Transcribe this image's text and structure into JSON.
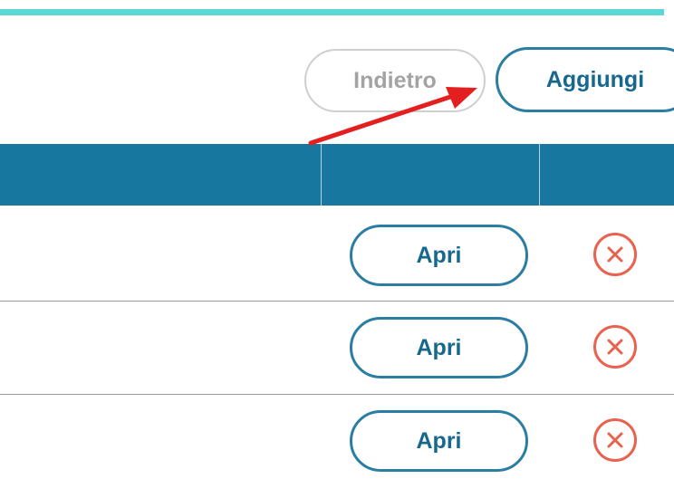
{
  "toolbar": {
    "back_label": "Indietro",
    "add_label": "Aggiungi"
  },
  "rows": [
    {
      "open_label": "Apri"
    },
    {
      "open_label": "Apri"
    },
    {
      "open_label": "Apri"
    }
  ],
  "colors": {
    "accent_top": "#5ad8d5",
    "header_bg": "#17779e",
    "primary": "#2b7ea1",
    "danger": "#e8634f",
    "annotation_arrow": "#e41f1f"
  },
  "icons": {
    "delete": "close-circle-icon",
    "annotation": "red-arrow"
  }
}
